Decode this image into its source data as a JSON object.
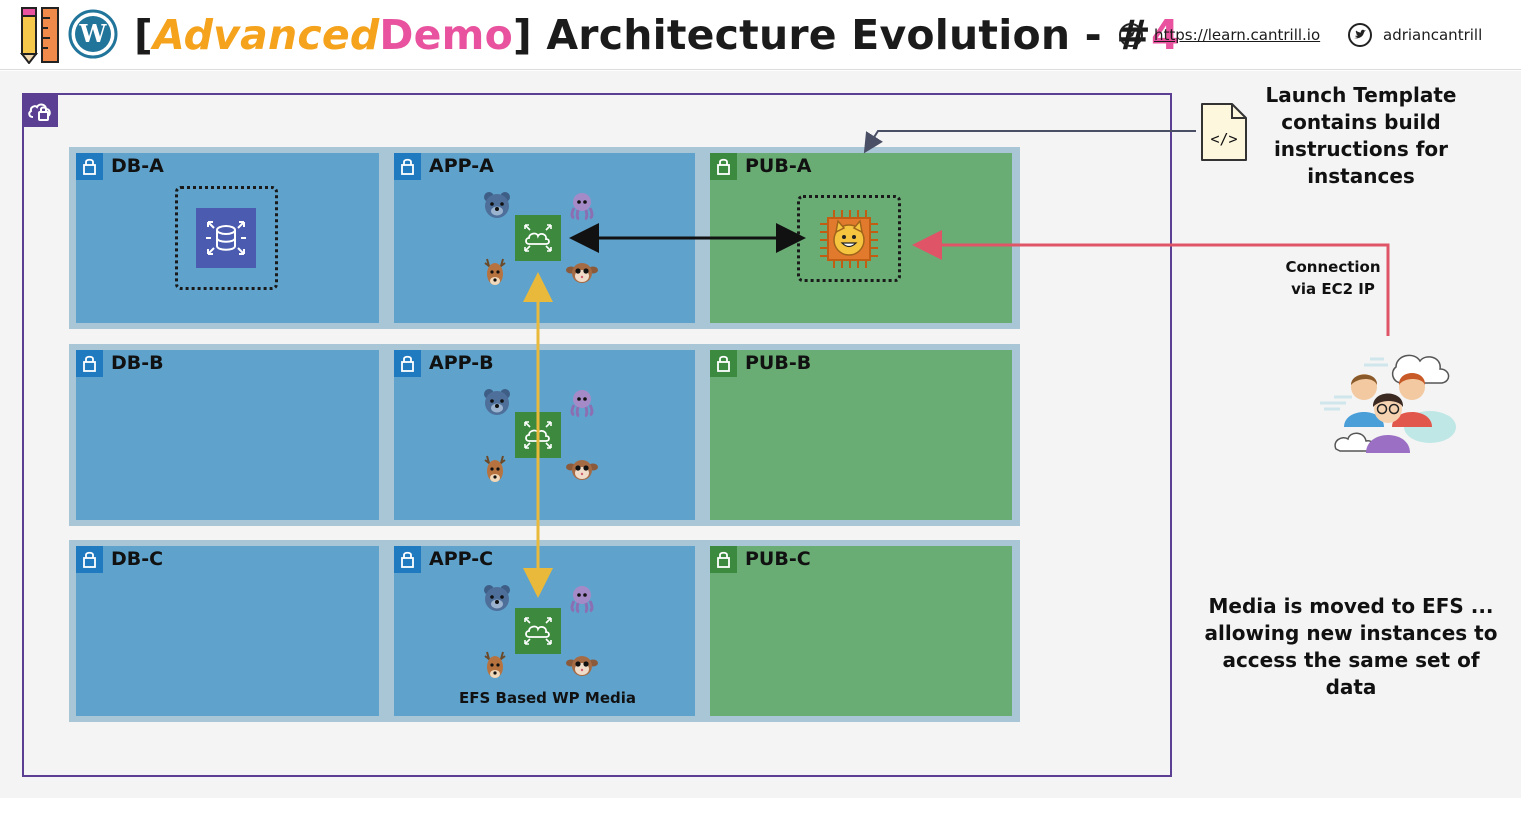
{
  "header": {
    "title_open_bracket": "[",
    "title_advanced": "Advanced",
    "title_demo": "Demo",
    "title_rest": "] Architecture Evolution - #",
    "title_number": "4",
    "site_link": "https://learn.cantrill.io",
    "twitter_handle": "adriancantrill",
    "icons": [
      "pencil-ruler-icon",
      "wordpress-icon",
      "compass-icon",
      "twitter-icon"
    ]
  },
  "colors": {
    "title_advanced": "#f5a21c",
    "title_demo": "#e8529e",
    "vpc_border": "#5a3f93",
    "private_subnet": "#5fa3cd",
    "public_subnet": "#69ad75",
    "efs_arrow": "#e8b93a",
    "connection_arrow": "#e05468"
  },
  "subnets": {
    "db_a": "DB-A",
    "app_a": "APP-A",
    "pub_a": "PUB-A",
    "db_b": "DB-B",
    "app_b": "APP-B",
    "pub_b": "PUB-B",
    "db_c": "DB-C",
    "app_c": "APP-C",
    "pub_c": "PUB-C"
  },
  "labels": {
    "efs_caption": "EFS Based WP Media",
    "launch_template_note": [
      "Launch Template",
      "contains build",
      "instructions for",
      "instances"
    ],
    "connection_note": [
      "Connection",
      "via EC2 IP"
    ],
    "efs_note": [
      "Media is moved to EFS ...",
      "allowing new instances to",
      "access the same set of data"
    ]
  },
  "icons": {
    "vpc": "vpc-cloud-icon",
    "rds": "rds-database-icon",
    "ec2": "ec2-instance-chip-icon",
    "efs": "efs-mount-target-icon",
    "launch_template": "code-document-icon",
    "users": "users-group-icon"
  }
}
